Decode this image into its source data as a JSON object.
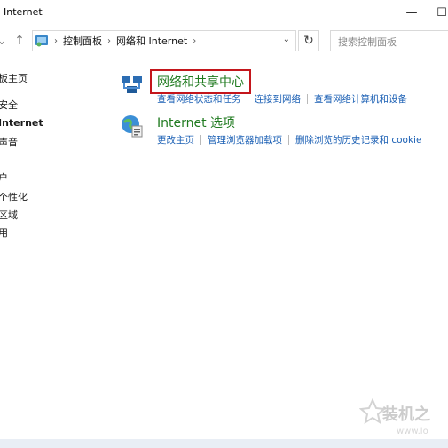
{
  "window": {
    "title": "Internet"
  },
  "controls": {
    "minimize": "—",
    "maximize": "☐"
  },
  "nav": {
    "up": "↑",
    "crumbs": [
      "控制面板",
      "网络和 Internet"
    ],
    "dropdown": "⌄",
    "refresh": "↻",
    "search_placeholder": "搜索控制面板"
  },
  "sidebar": {
    "items": [
      {
        "label": "板主页"
      },
      {
        "label": "安全"
      },
      {
        "label": "Internet",
        "active": true
      },
      {
        "label": "声音"
      },
      {
        "label": "户"
      },
      {
        "label": "个性化"
      },
      {
        "label": "区域"
      },
      {
        "label": "用"
      }
    ]
  },
  "categories": [
    {
      "title": "网络和共享中心",
      "icon": "network-center-icon",
      "highlighted": true,
      "links": [
        "查看网络状态和任务",
        "连接到网络",
        "查看网络计算机和设备"
      ]
    },
    {
      "title": "Internet 选项",
      "icon": "internet-options-icon",
      "highlighted": false,
      "links": [
        "更改主页",
        "管理浏览器加载项",
        "删除浏览的历史记录和 cookie"
      ]
    }
  ],
  "watermark": {
    "text": "装机之",
    "url": "www.lo"
  },
  "colors": {
    "link": "#1a5fb4",
    "title_green": "#1f7a1f",
    "highlight_box": "#c4161c"
  }
}
